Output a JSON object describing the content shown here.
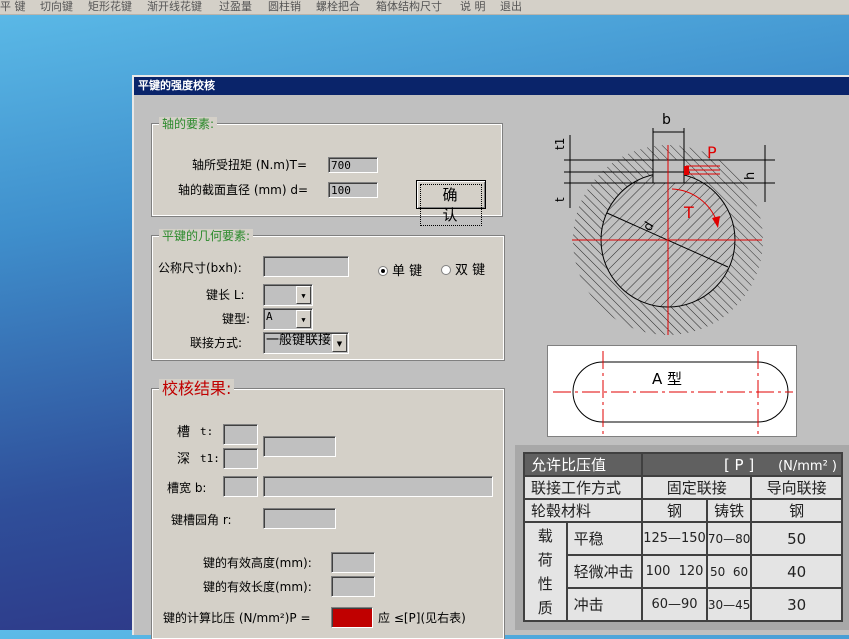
{
  "menu": [
    "平 键",
    "切向键",
    "矩形花键",
    "渐开线花键",
    "过盈量",
    "圆柱销",
    "螺栓把合",
    "箱体结构尺寸",
    "说 明",
    "退出"
  ],
  "window": {
    "title": "平键的强度校核"
  },
  "shaft": {
    "title": "轴的要素:",
    "torque_label": "轴所受扭矩 (N.m)T=",
    "torque_value": "700",
    "diameter_label": "轴的截面直径 (mm) d=",
    "diameter_value": "100",
    "confirm": "确 认"
  },
  "geometry": {
    "title": "平键的几何要素:",
    "nominal_label": "公称尺寸(bxh):",
    "nominal_value": "",
    "single": "单 键",
    "double": "双 键",
    "selected": "single",
    "length_label": "键长 L:",
    "length_value": "",
    "type_label": "键型:",
    "type_value": "A",
    "conn_label": "联接方式:",
    "conn_value": "一般键联接"
  },
  "result": {
    "title": "校核结果:",
    "slot_t": "t:",
    "slot_t1": "t1:",
    "slot_char1": "槽",
    "slot_char2": "深",
    "width_label": "槽宽 b:",
    "radius_label": "键槽园角 r:",
    "height_label": "键的有效高度(mm):",
    "len_label": "键的有效长度(mm):",
    "pressure_label": "键的计算比压 (N/mm²)P =",
    "pressure_note": "应 ≤[P](见右表)",
    "pressure_color": "#c00000"
  },
  "diagram": {
    "b": "b",
    "t1": "t1",
    "t": "t",
    "h": "h",
    "P": "P",
    "T": "T",
    "d": "d",
    "key_type": "A 型"
  },
  "table": {
    "header": [
      "允许比压值",
      "[ P ]",
      "(N/mm² )"
    ],
    "row_mode": [
      "联接工作方式",
      "固定联接",
      "导向联接"
    ],
    "row_material": [
      "轮毂材料",
      "钢",
      "铸铁",
      "钢"
    ],
    "load_label": "载荷性质",
    "loads": [
      [
        "平稳",
        "125—150",
        "70—80",
        "50"
      ],
      [
        "轻微冲击",
        "100  120",
        "50  60",
        "40"
      ],
      [
        "冲击",
        "60—90",
        "30—45",
        "30"
      ]
    ]
  }
}
